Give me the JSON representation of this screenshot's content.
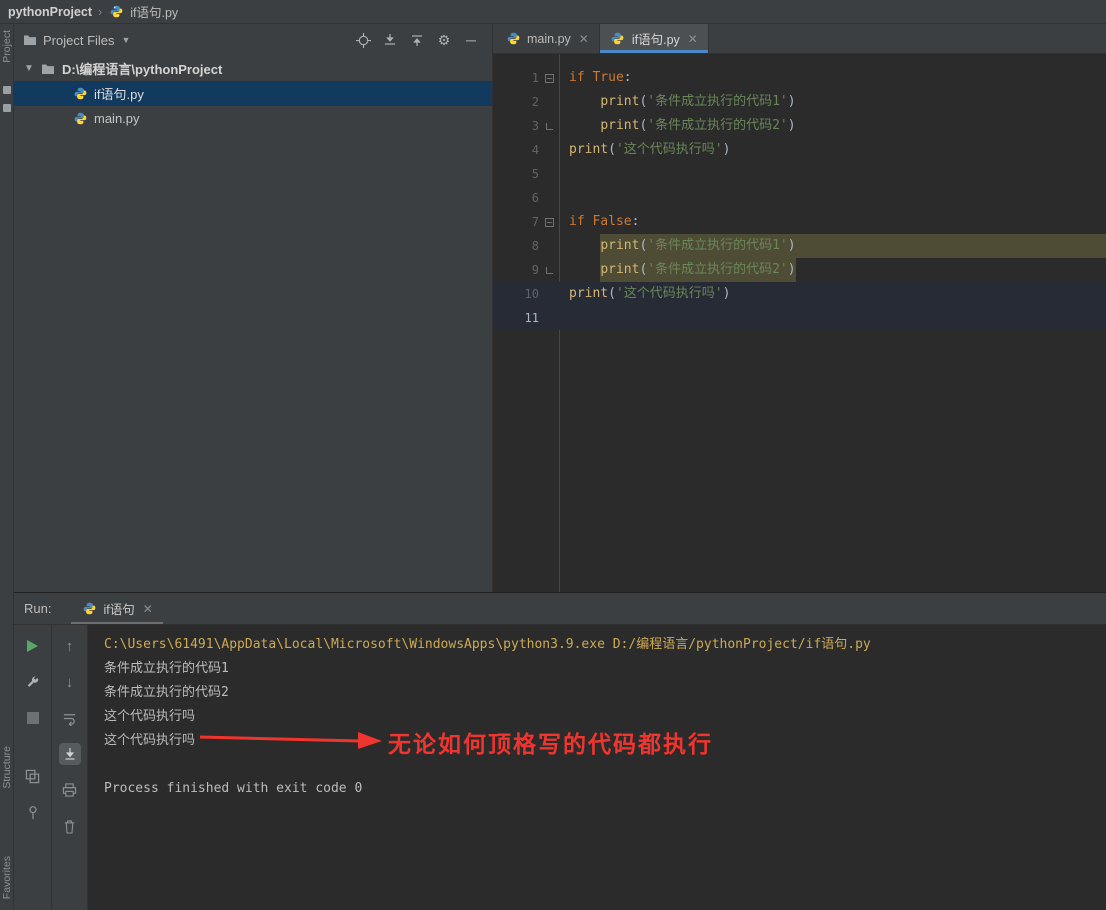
{
  "colors": {
    "accent_blue": "#4a88c7",
    "tree_selection": "#123a5f",
    "selection_olive": "#4f4c35",
    "row_highlight": "#262b36",
    "keyword": "#cc7832",
    "string": "#6a8759",
    "builtin": "#d3b673",
    "plain": "#a9b7c6",
    "command_yellow": "#cdaa53",
    "output_grey": "#bcbcbc",
    "annotation_red": "#f0342e",
    "run_green": "#59a869"
  },
  "topbar": {
    "breadcrumb_project": "pythonProject",
    "breadcrumb_separator": "›",
    "breadcrumb_file": "if语句.py"
  },
  "left_strip": {
    "top_label": "Project",
    "bottom_labels": [
      "Structure",
      "Favorites"
    ]
  },
  "project_panel": {
    "header_title": "Project Files",
    "root_label": "D:\\编程语言\\pythonProject",
    "files": [
      {
        "name": "if语句.py",
        "selected": true
      },
      {
        "name": "main.py",
        "selected": false
      }
    ]
  },
  "editor": {
    "tabs": [
      {
        "label": "main.py",
        "active": false
      },
      {
        "label": "if语句.py",
        "active": true
      }
    ],
    "lines": [
      {
        "num": "1",
        "fold": "start",
        "hl": "",
        "tokens": [
          [
            "if True",
            "kw"
          ],
          [
            ":",
            "pl"
          ]
        ]
      },
      {
        "num": "2",
        "fold": "",
        "hl": "",
        "tokens": [
          [
            "    ",
            "pl"
          ],
          [
            "print",
            "fn"
          ],
          [
            "(",
            "pl"
          ],
          [
            "'条件成立执行的代码1'",
            "str"
          ],
          [
            ")",
            "pl"
          ]
        ]
      },
      {
        "num": "3",
        "fold": "end",
        "hl": "",
        "tokens": [
          [
            "    ",
            "pl"
          ],
          [
            "print",
            "fn"
          ],
          [
            "(",
            "pl"
          ],
          [
            "'条件成立执行的代码2'",
            "str"
          ],
          [
            ")",
            "pl"
          ]
        ]
      },
      {
        "num": "4",
        "fold": "",
        "hl": "",
        "tokens": [
          [
            "print",
            "fn"
          ],
          [
            "(",
            "pl"
          ],
          [
            "'这个代码执行吗'",
            "str"
          ],
          [
            ")",
            "pl"
          ]
        ]
      },
      {
        "num": "5",
        "fold": "",
        "hl": "",
        "tokens": []
      },
      {
        "num": "6",
        "fold": "",
        "hl": "",
        "tokens": []
      },
      {
        "num": "7",
        "fold": "start",
        "hl": "",
        "tokens": [
          [
            "if False",
            "kw"
          ],
          [
            ":",
            "pl"
          ]
        ]
      },
      {
        "num": "8",
        "fold": "",
        "hl": "sel-full",
        "tokens": [
          [
            "    ",
            "pl"
          ],
          [
            "print",
            "fn"
          ],
          [
            "(",
            "pl"
          ],
          [
            "'条件成立执行的代码1'",
            "str"
          ],
          [
            ")",
            "pl"
          ]
        ]
      },
      {
        "num": "9",
        "fold": "end",
        "hl": "sel-text",
        "tokens": [
          [
            "    ",
            "pl"
          ],
          [
            "print",
            "fn"
          ],
          [
            "(",
            "pl"
          ],
          [
            "'条件成立执行的代码2'",
            "str"
          ],
          [
            ")",
            "pl"
          ]
        ]
      },
      {
        "num": "10",
        "fold": "",
        "hl": "row",
        "tokens": [
          [
            "print",
            "fn"
          ],
          [
            "(",
            "pl"
          ],
          [
            "'这个代码执行吗'",
            "str"
          ],
          [
            ")",
            "pl"
          ]
        ]
      },
      {
        "num": "11",
        "fold": "",
        "hl": "row caret",
        "tokens": []
      }
    ]
  },
  "run_panel": {
    "label": "Run:",
    "tab_label": "if语句",
    "console_lines": [
      {
        "type": "cmd",
        "text": "C:\\Users\\61491\\AppData\\Local\\Microsoft\\WindowsApps\\python3.9.exe D:/编程语言/pythonProject/if语句.py"
      },
      {
        "type": "out",
        "text": "条件成立执行的代码1"
      },
      {
        "type": "out",
        "text": "条件成立执行的代码2"
      },
      {
        "type": "out",
        "text": "这个代码执行吗"
      },
      {
        "type": "out",
        "text": "这个代码执行吗"
      },
      {
        "type": "blank",
        "text": ""
      },
      {
        "type": "out",
        "text": "Process finished with exit code 0"
      }
    ],
    "annotation_text": "无论如何顶格写的代码都执行"
  }
}
